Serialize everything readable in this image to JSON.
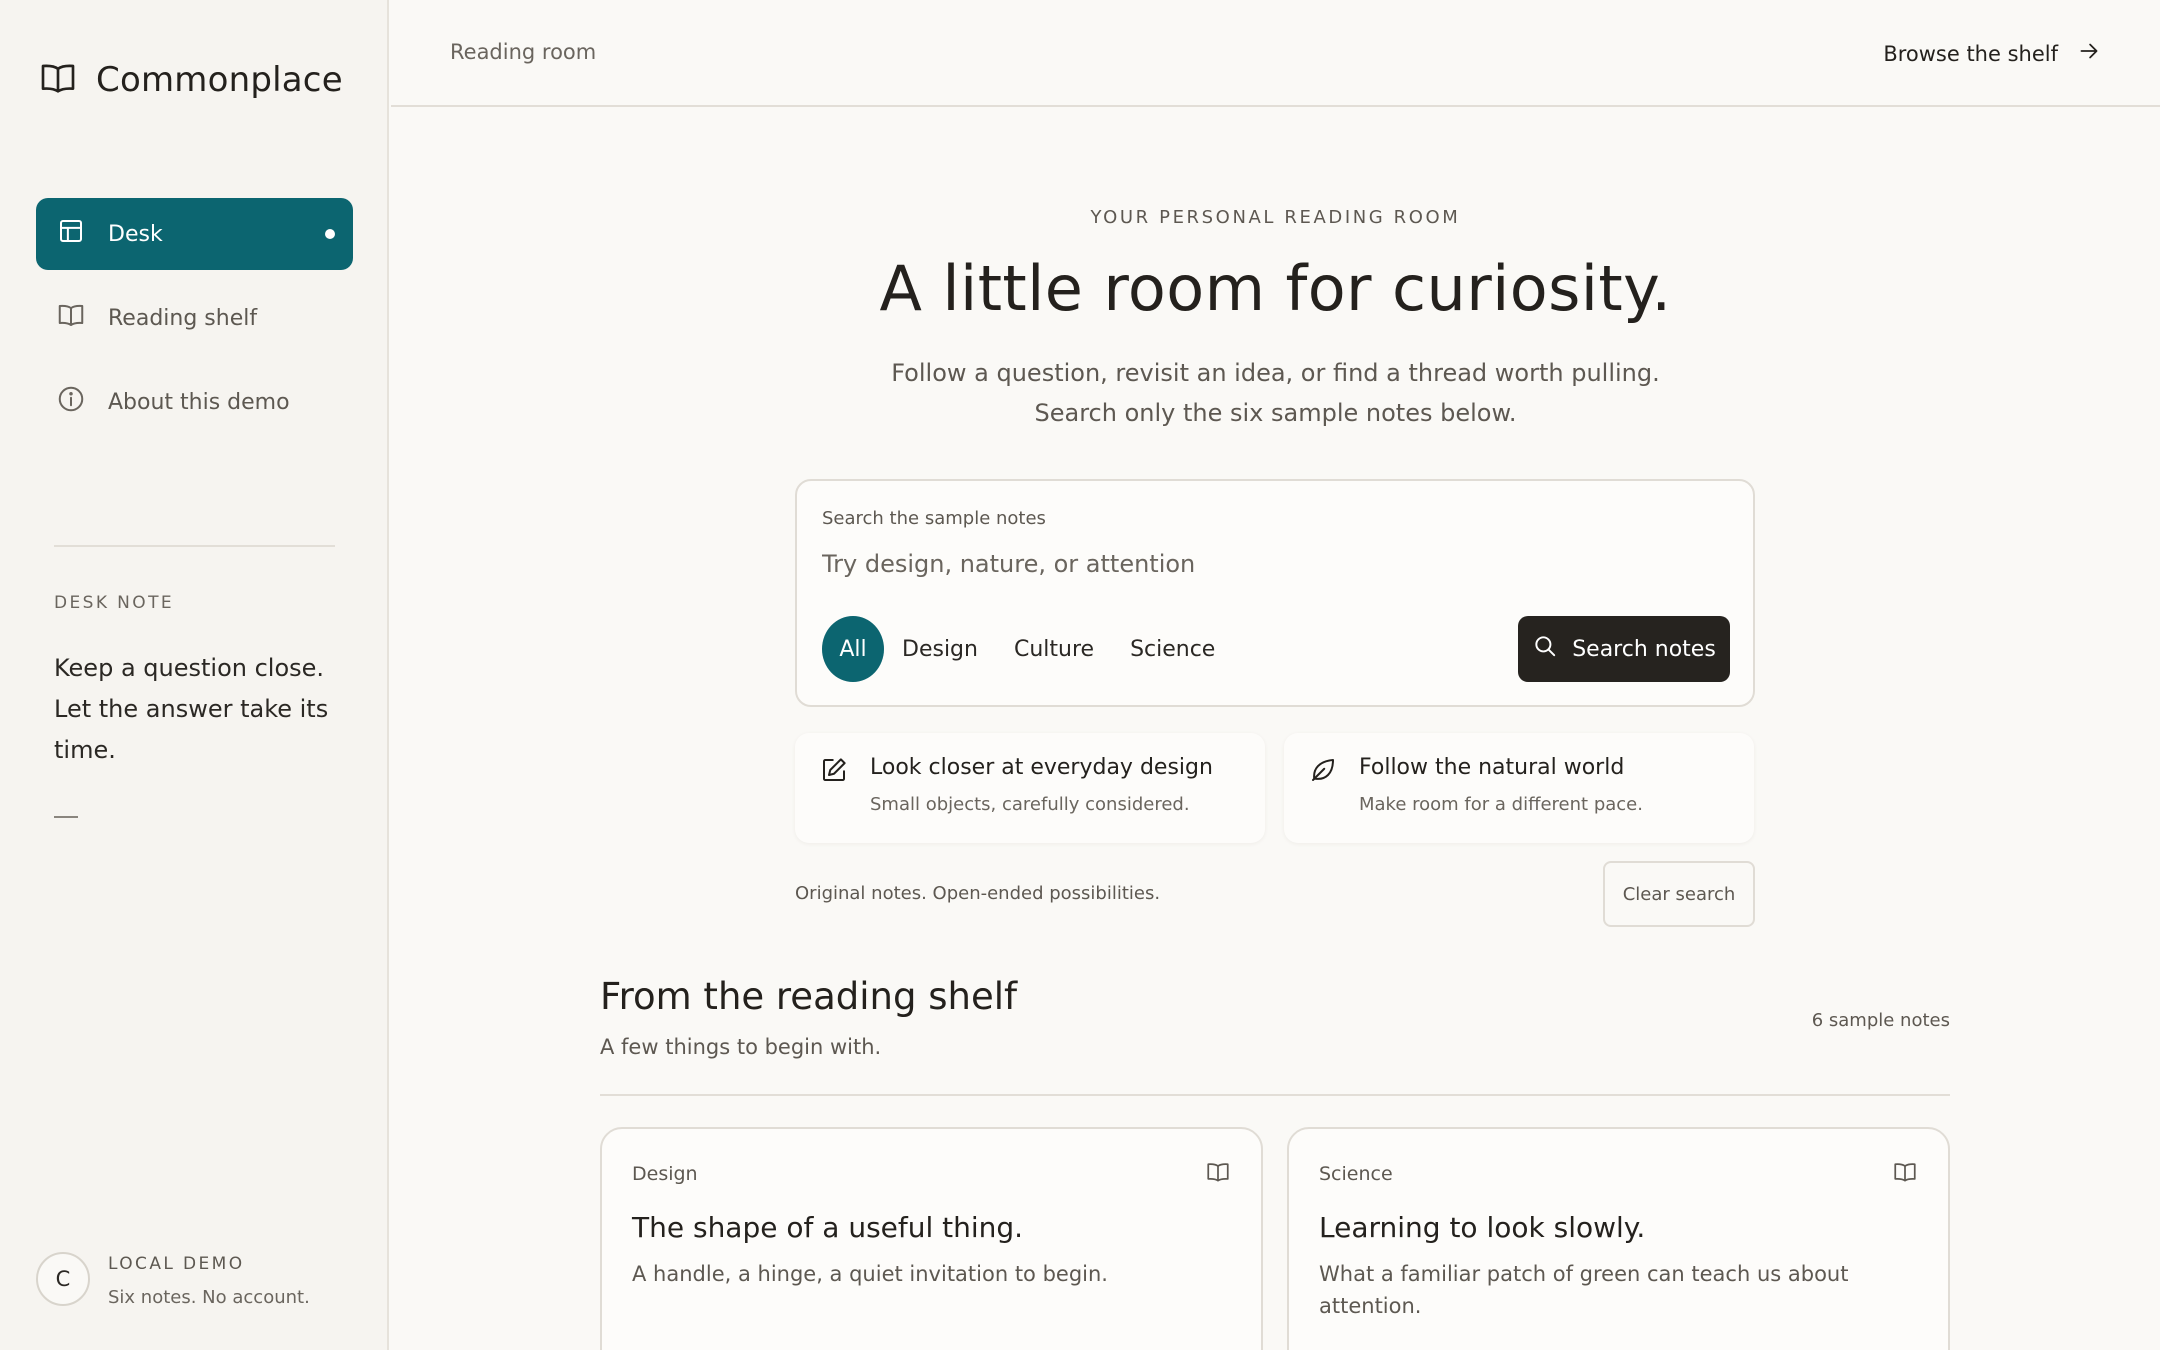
{
  "app": {
    "name": "Commonplace"
  },
  "sidebar": {
    "nav": [
      {
        "label": "Desk",
        "icon": "layout-icon",
        "active": true
      },
      {
        "label": "Reading shelf",
        "icon": "book-icon",
        "active": false
      },
      {
        "label": "About this demo",
        "icon": "info-icon",
        "active": false
      }
    ],
    "desk_note": {
      "label": "DESK NOTE",
      "text": "Keep a question close. Let the answer take its time.",
      "dash": "—"
    },
    "local": {
      "avatar": "C",
      "title": "LOCAL DEMO",
      "subtitle": "Six notes. No account."
    }
  },
  "topbar": {
    "breadcrumb": "Reading room",
    "browse_label": "Browse the shelf"
  },
  "hero": {
    "eyebrow": "YOUR PERSONAL READING ROOM",
    "headline": "A little room for curiosity.",
    "subline_1": "Follow a question, revisit an idea, or find a thread worth pulling.",
    "subline_2": "Search only the six sample notes below."
  },
  "search": {
    "label": "Search the sample notes",
    "value": "",
    "placeholder": "Try design, nature, or attention",
    "filters": [
      "All",
      "Design",
      "Culture",
      "Science"
    ],
    "active_filter": "All",
    "button_label": "Search notes"
  },
  "suggestions": [
    {
      "title": "Look closer at everyday design",
      "subtitle": "Small objects, carefully considered.",
      "icon": "pencil-square-icon"
    },
    {
      "title": "Follow the natural world",
      "subtitle": "Make room for a different pace.",
      "icon": "leaf-icon"
    }
  ],
  "footer_note": "Original notes. Open-ended possibilities.",
  "clear_label": "Clear search",
  "shelf": {
    "title": "From the reading shelf",
    "subtitle": "A few things to begin with.",
    "count": "6 sample notes",
    "notes": [
      {
        "category": "Design",
        "title": "The shape of a useful thing.",
        "description": "A handle, a hinge, a quiet invitation to begin."
      },
      {
        "category": "Science",
        "title": "Learning to look slowly.",
        "description": "What a familiar patch of green can teach us about attention."
      }
    ]
  },
  "colors": {
    "accent": "#0c6570",
    "dark_button": "#26231f",
    "background": "#faf9f6",
    "sidebar": "#f6f4f0"
  }
}
